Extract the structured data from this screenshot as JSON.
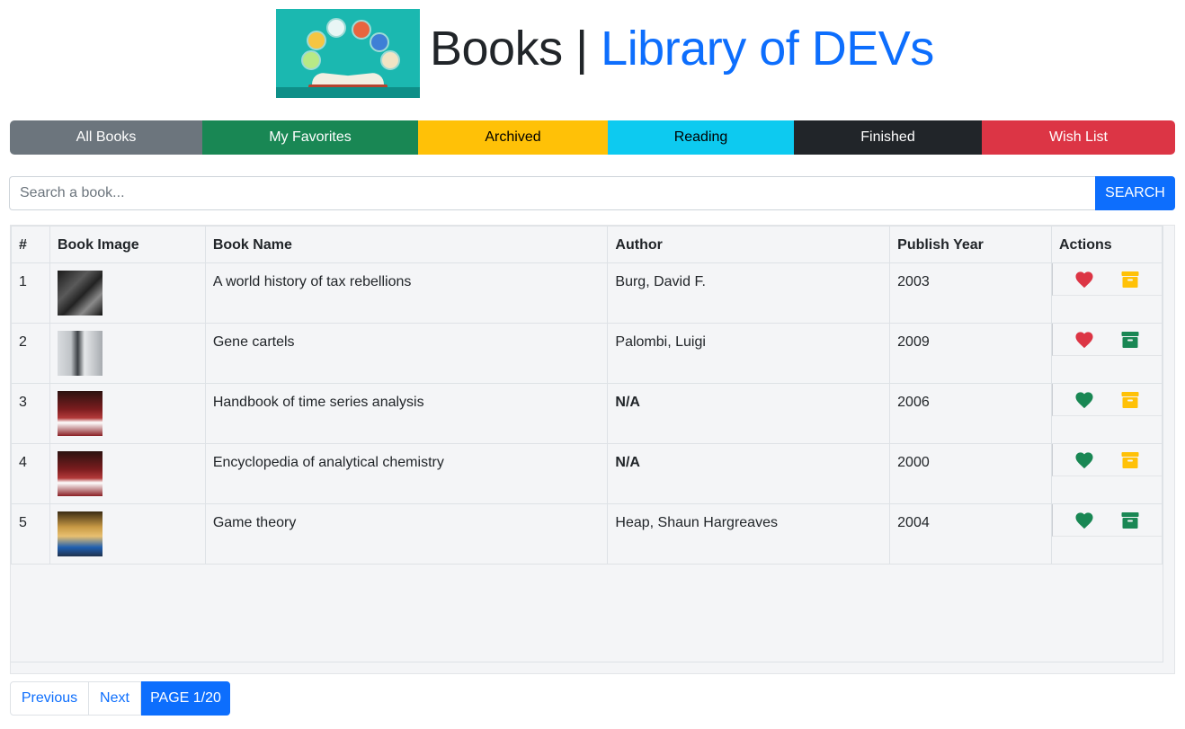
{
  "header": {
    "title_part1": "Books",
    "separator": "|",
    "title_part2": "Library of DEVs"
  },
  "filters": [
    {
      "label": "All Books",
      "color": "#6c757d"
    },
    {
      "label": "My Favorites",
      "color": "#198754"
    },
    {
      "label": "Archived",
      "color": "#ffc107"
    },
    {
      "label": "Reading",
      "color": "#0dcaf0"
    },
    {
      "label": "Finished",
      "color": "#212529"
    },
    {
      "label": "Wish List",
      "color": "#dc3545"
    }
  ],
  "search": {
    "placeholder": "Search a book...",
    "value": "",
    "button_label": "SEARCH"
  },
  "table": {
    "columns": [
      "#",
      "Book Image",
      "Book Name",
      "Author",
      "Publish Year",
      "Actions"
    ],
    "rows": [
      {
        "num": "1",
        "name": "A world history of tax rebellions",
        "author": "Burg, David F.",
        "year": "2003",
        "favorite_icon": "heart-icon",
        "favorite_color": "#dc3545",
        "archive_icon": "archive-box-icon",
        "archive_color": "#ffc107"
      },
      {
        "num": "2",
        "name": "Gene cartels",
        "author": "Palombi, Luigi",
        "year": "2009",
        "favorite_icon": "heart-icon",
        "favorite_color": "#dc3545",
        "archive_icon": "archive-box-icon",
        "archive_color": "#198754"
      },
      {
        "num": "3",
        "name": "Handbook of time series analysis",
        "author": "N/A",
        "year": "2006",
        "favorite_icon": "heart-icon",
        "favorite_color": "#198754",
        "archive_icon": "archive-box-icon",
        "archive_color": "#ffc107"
      },
      {
        "num": "4",
        "name": "Encyclopedia of analytical chemistry",
        "author": "N/A",
        "year": "2000",
        "favorite_icon": "heart-icon",
        "favorite_color": "#198754",
        "archive_icon": "archive-box-icon",
        "archive_color": "#ffc107"
      },
      {
        "num": "5",
        "name": "Game theory",
        "author": "Heap, Shaun Hargreaves",
        "year": "2004",
        "favorite_icon": "heart-icon",
        "favorite_color": "#198754",
        "archive_icon": "archive-box-icon",
        "archive_color": "#198754"
      }
    ]
  },
  "pagination": {
    "previous_label": "Previous",
    "next_label": "Next",
    "page_label": "PAGE 1/20"
  },
  "colors": {
    "primary": "#0d6efd",
    "danger": "#dc3545",
    "success": "#198754",
    "warning": "#ffc107"
  }
}
